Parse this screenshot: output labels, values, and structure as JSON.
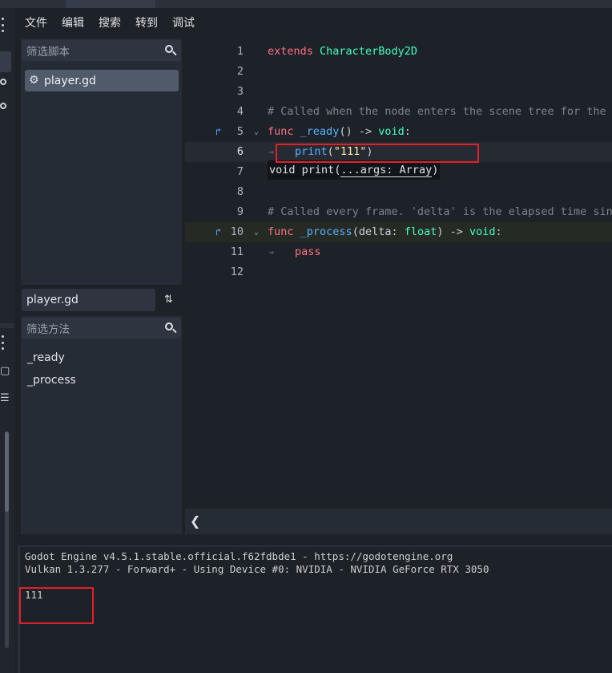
{
  "menu": {
    "items": [
      "文件",
      "编辑",
      "搜索",
      "转到",
      "调试"
    ]
  },
  "scripts_panel": {
    "filter_placeholder": "筛选脚本",
    "items": [
      "player.gd"
    ],
    "current_file": "player.gd"
  },
  "methods_panel": {
    "filter_placeholder": "筛选方法",
    "items": [
      "_ready",
      "_process"
    ]
  },
  "editor": {
    "line_numbers": [
      "1",
      "2",
      "3",
      "4",
      "5",
      "6",
      "7",
      "8",
      "9",
      "10",
      "11",
      "12"
    ],
    "lines": {
      "l1_kw": "extends",
      "l1_type": "CharacterBody2D",
      "l4_comment": "# Called when the node enters the scene tree for the first time.",
      "l5_kw": "func",
      "l5_fn": "_ready",
      "l5_rest": "() -> ",
      "l5_ret": "void",
      "l5_colon": ":",
      "l6_fn": "print",
      "l6_open": "(",
      "l6_str": "\"111\"",
      "l6_close": ")",
      "l9_comment": "# Called every frame. 'delta' is the elapsed time since the previous frame.",
      "l10_kw": "func",
      "l10_fn": "_process",
      "l10_p1": "(delta: ",
      "l10_type": "float",
      "l10_p2": ") -> ",
      "l10_ret": "void",
      "l10_colon": ":",
      "l11_kw": "pass"
    },
    "tooltip": {
      "prefix": "void print(",
      "args": "...args: Array",
      "suffix": ")"
    },
    "icons": {
      "jump": "jump-to-definition-icon",
      "fold": "fold-arrow-icon",
      "tab": "tab-marker-icon"
    }
  },
  "output": {
    "lines": [
      "Godot Engine v4.5.1.stable.official.f62fdbde1 - https://godotengine.org",
      "Vulkan 1.3.277 - Forward+ - Using Device #0: NVIDIA - NVIDIA GeForce RTX 3050",
      "111"
    ]
  },
  "colors": {
    "keyword": "#ff7085",
    "type": "#42ffc2",
    "function": "#57b3ff",
    "string": "#ffeda1",
    "comment": "#7d838d",
    "annotation_box": "#e2202a"
  }
}
